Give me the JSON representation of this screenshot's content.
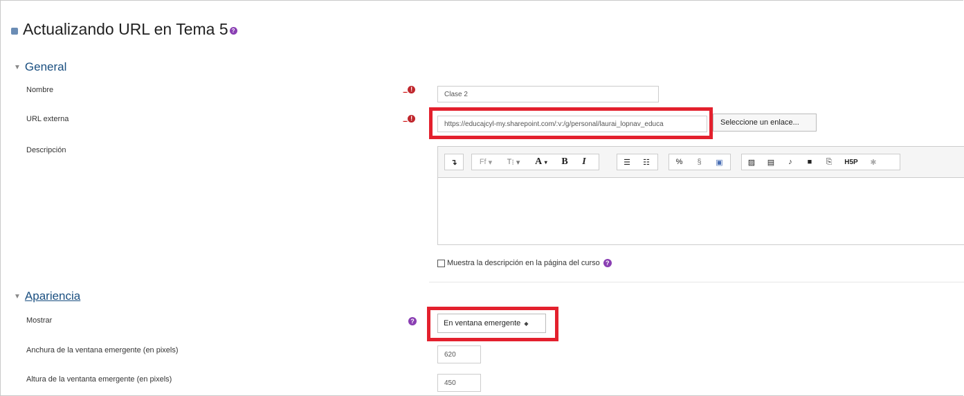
{
  "page": {
    "title": "Actualizando URL en Tema 5"
  },
  "sections": {
    "general": "General",
    "appearance": "Apariencia"
  },
  "fields": {
    "name": {
      "label": "Nombre",
      "value": "Clase 2"
    },
    "url": {
      "label": "URL externa",
      "value": "https://educajcyl-my.sharepoint.com/:v:/g/personal/laurai_lopnav_educa",
      "button": "Seleccione un enlace..."
    },
    "description": {
      "label": "Descripción",
      "show_on_course_label": "Muestra la descripción en la página del curso"
    },
    "display": {
      "label": "Mostrar",
      "selected": "En ventana emergente"
    },
    "popup_width": {
      "label": "Anchura de la ventana emergente (en pixels)",
      "value": "620"
    },
    "popup_height": {
      "label": "Altura de la ventanta emergente (en pixels)",
      "value": "450"
    }
  },
  "toolbar": {
    "font_family": "Ff",
    "font_size": "T",
    "bold": "B",
    "italic": "I",
    "h5p": "H5P"
  },
  "colors": {
    "highlight": "#e3202d",
    "required": "#c0272d",
    "help": "#8a3fb3",
    "section": "#1a4f80"
  }
}
